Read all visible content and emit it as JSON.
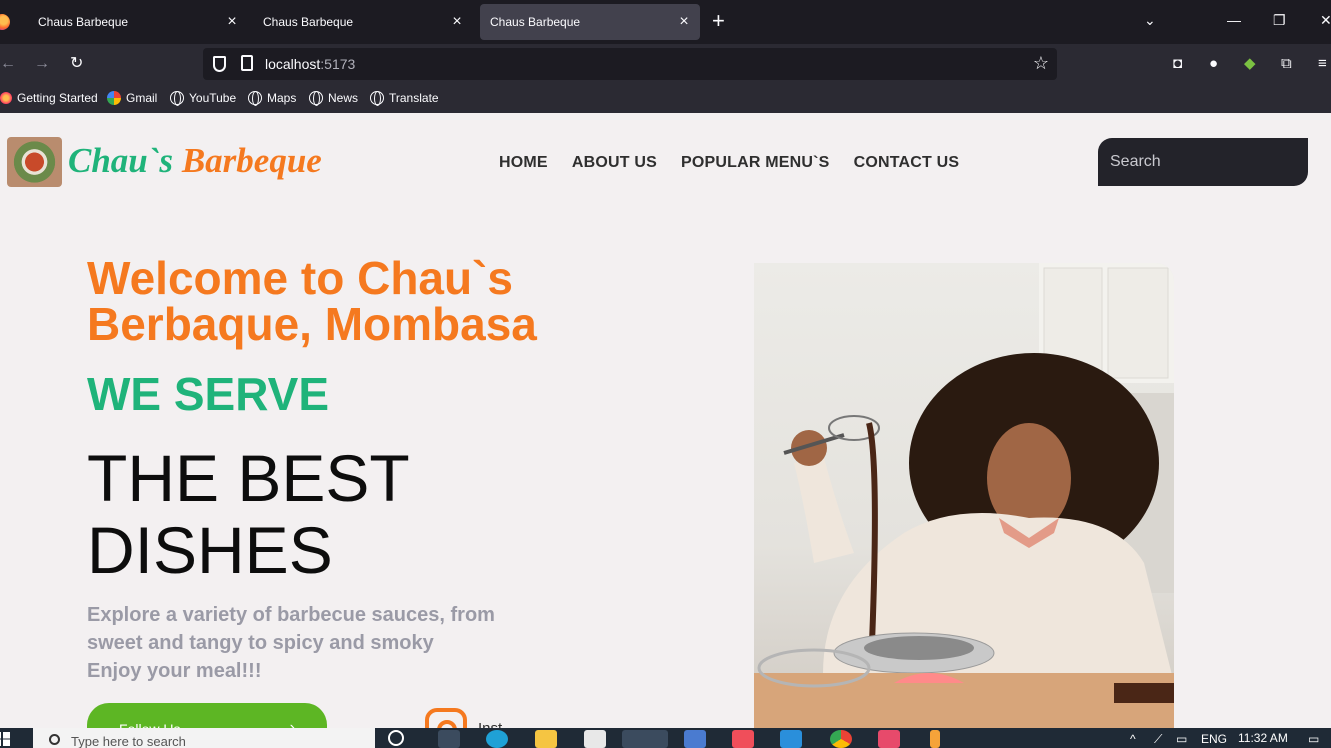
{
  "browser": {
    "tabs": [
      {
        "title": "Chaus Barbeque",
        "active": false
      },
      {
        "title": "Chaus Barbeque",
        "active": false
      },
      {
        "title": "Chaus Barbeque",
        "active": true
      }
    ],
    "url_host": "localhost",
    "url_port": ":5173",
    "bookmarks": [
      "Getting Started",
      "Gmail",
      "YouTube",
      "Maps",
      "News",
      "Translate"
    ]
  },
  "site": {
    "brand_part1": "Chau`s",
    "brand_part2": "Barbeque",
    "menu": [
      "HOME",
      "ABOUT US",
      "POPULAR MENU`S",
      "CONTACT US"
    ],
    "search_placeholder": "Search",
    "hero": {
      "title": "Welcome to Chau`s Berbaque, Mombasa",
      "serve": "WE SERVE",
      "best": "THE BEST DISHES",
      "desc_line1": "Explore a variety of barbecue sauces, from",
      "desc_line2": "sweet and tangy to spicy and smoky",
      "desc_line3": "Enjoy your meal!!!",
      "follow_label": "Follow Us ...",
      "instagram_label": "Inst..."
    },
    "colors": {
      "brand_green": "#1fb37a",
      "brand_orange": "#f5791f",
      "button_green": "#5db624"
    }
  },
  "taskbar": {
    "search_placeholder": "Type here to search",
    "language": "ENG",
    "time": "11:32 AM"
  }
}
